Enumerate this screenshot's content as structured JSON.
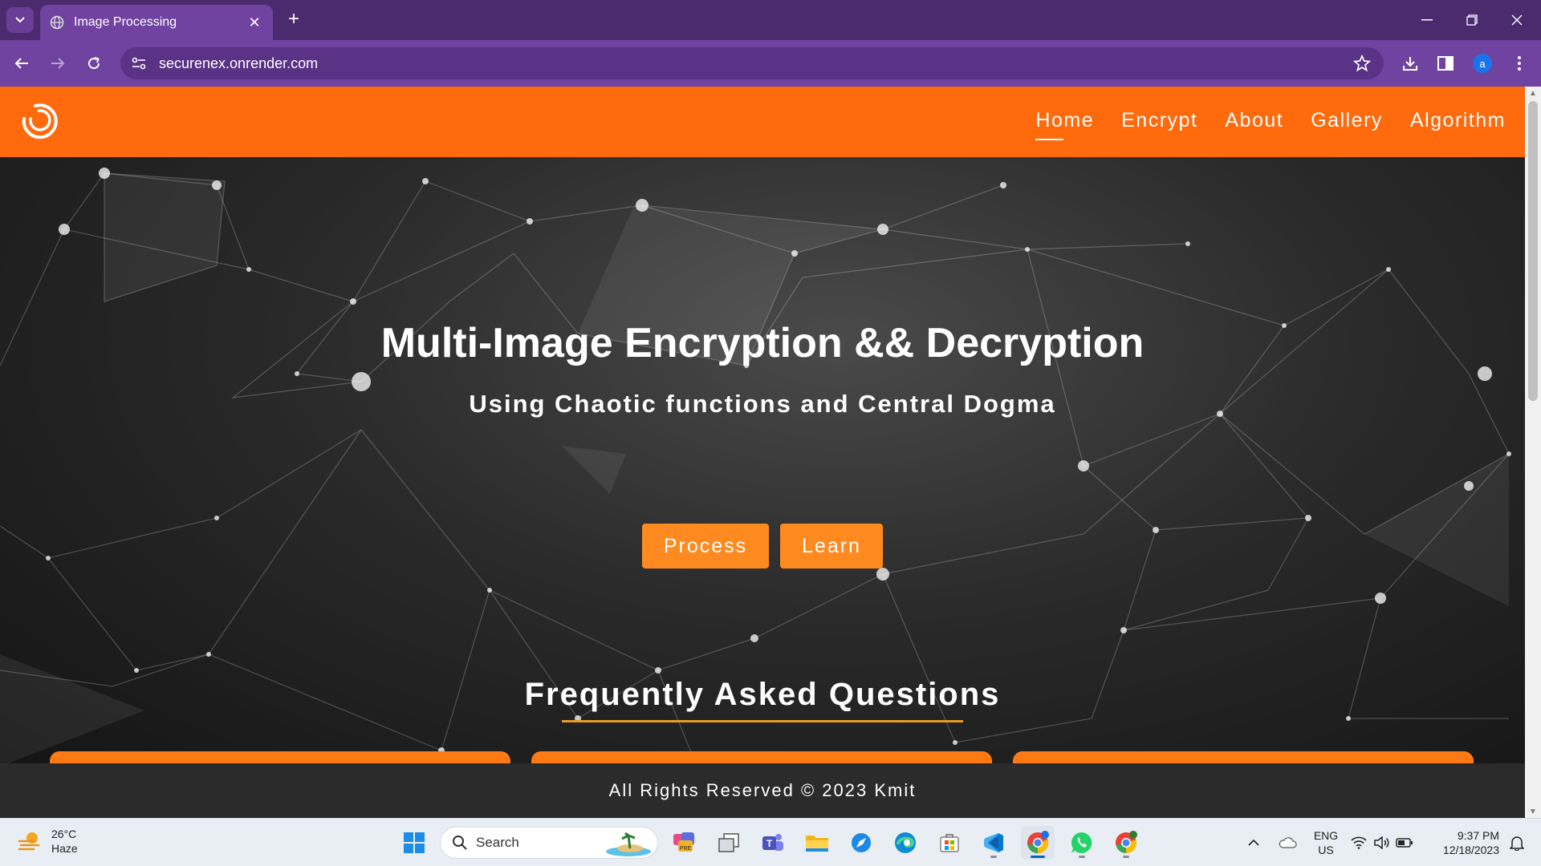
{
  "browser": {
    "tab_title": "Image Processing",
    "url": "securenex.onrender.com",
    "profile_initial": "a"
  },
  "site": {
    "nav": [
      "Home",
      "Encrypt",
      "About",
      "Gallery",
      "Algorithm"
    ],
    "active_nav": "Home",
    "hero_title": "Multi-Image Encryption && Decryption",
    "hero_subtitle": "Using Chaotic functions and Central Dogma",
    "buttons": {
      "process": "Process",
      "learn": "Learn"
    },
    "faq_title": "Frequently Asked Questions",
    "footer": "All Rights Reserved © 2023 Kmit",
    "colors": {
      "header": "#ff6a0d",
      "button": "#ff8a1f",
      "underline": "#e89c21"
    }
  },
  "taskbar": {
    "weather_temp": "26°C",
    "weather_desc": "Haze",
    "search_placeholder": "Search",
    "lang_line1": "ENG",
    "lang_line2": "US",
    "time": "9:37 PM",
    "date": "12/18/2023",
    "apps": [
      "windows-start-icon",
      "task-view-icon",
      "teams-icon",
      "file-explorer-icon",
      "safari-like-icon",
      "edge-icon",
      "store-icon",
      "vscode-icon",
      "chrome-icon",
      "whatsapp-icon",
      "chrome-profile-icon"
    ]
  }
}
